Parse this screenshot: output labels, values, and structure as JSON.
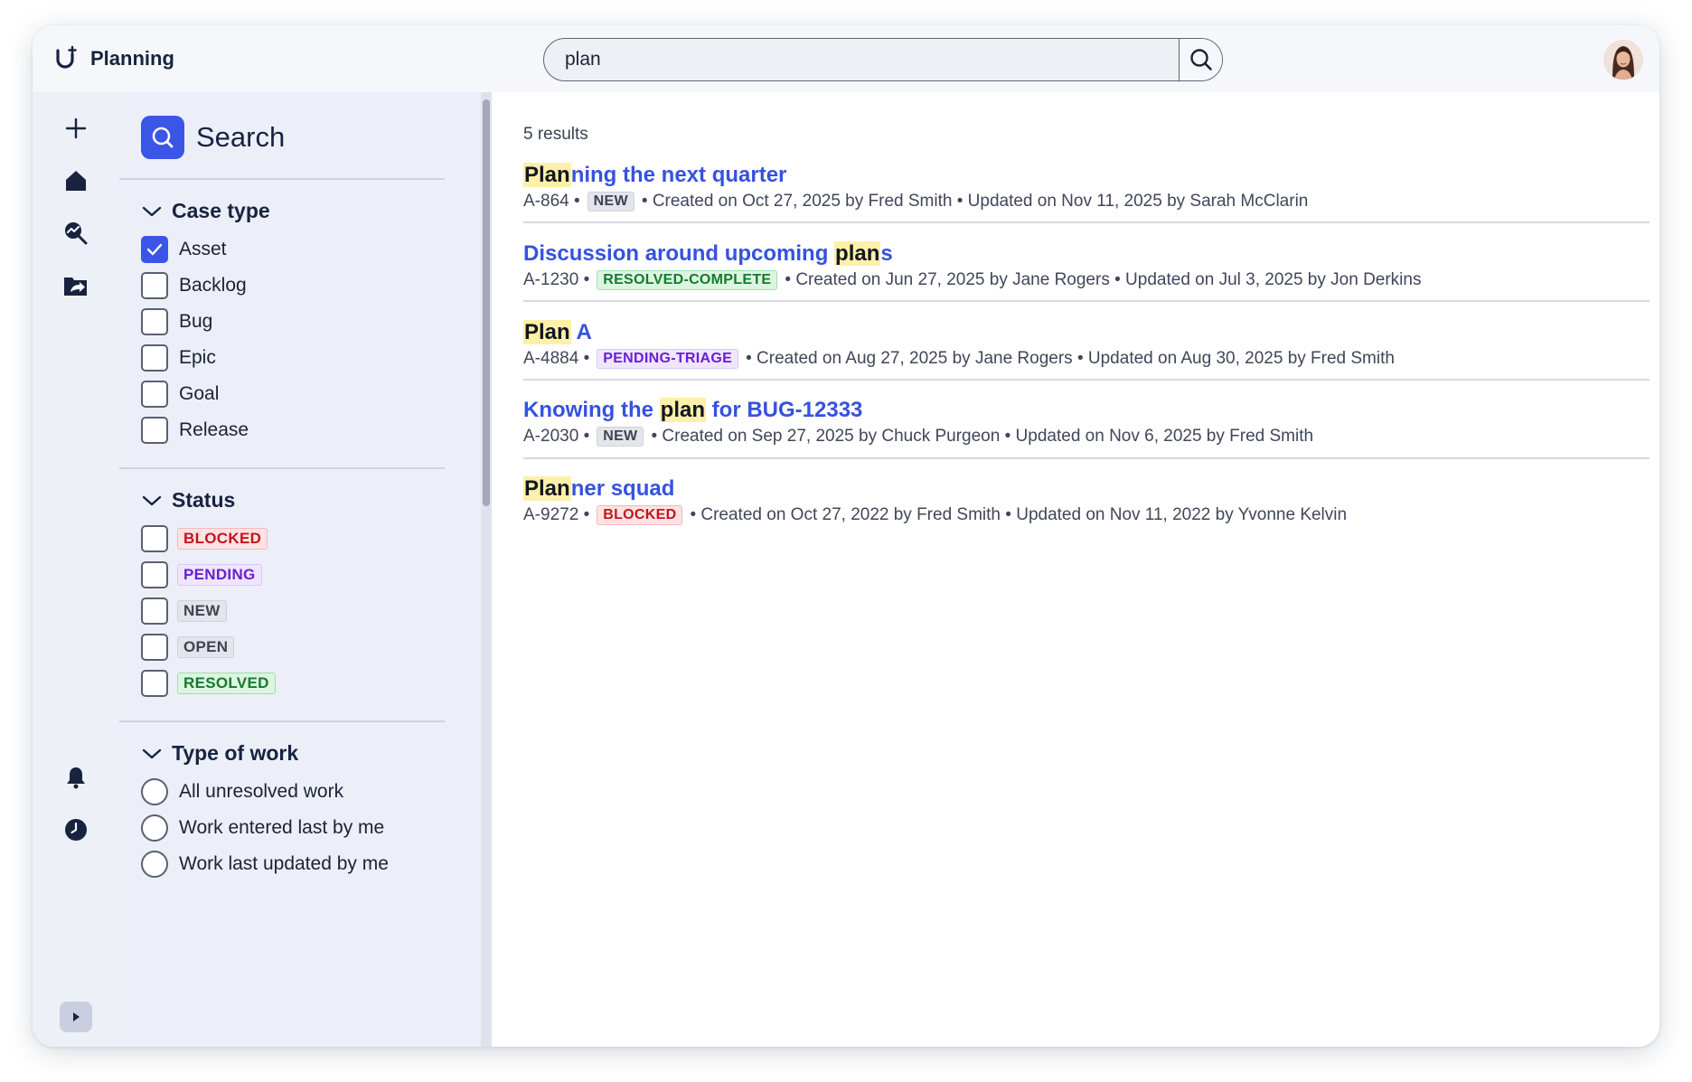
{
  "app": {
    "title": "Planning"
  },
  "search": {
    "query": "plan"
  },
  "sidebar": {
    "heading": "Search",
    "sections": {
      "case_type": {
        "label": "Case type",
        "options": [
          {
            "label": "Asset",
            "checked": true
          },
          {
            "label": "Backlog",
            "checked": false
          },
          {
            "label": "Bug",
            "checked": false
          },
          {
            "label": "Epic",
            "checked": false
          },
          {
            "label": "Goal",
            "checked": false
          },
          {
            "label": "Release",
            "checked": false
          }
        ]
      },
      "status": {
        "label": "Status",
        "options": [
          {
            "label": "BLOCKED"
          },
          {
            "label": "PENDING"
          },
          {
            "label": "NEW"
          },
          {
            "label": "OPEN"
          },
          {
            "label": "RESOLVED"
          }
        ]
      },
      "type_of_work": {
        "label": "Type of work",
        "options": [
          {
            "label": "All unresolved work"
          },
          {
            "label": "Work entered last by me"
          },
          {
            "label": "Work last updated by me"
          }
        ]
      }
    }
  },
  "results": {
    "count_label": "5 results",
    "items": [
      {
        "title_pre": "",
        "title_hl": "Plan",
        "title_post": "ning the next quarter",
        "id": "A-864",
        "status": "NEW",
        "created": "Created on Oct 27, 2025 by Fred Smith",
        "updated": "Updated on Nov 11, 2025 by Sarah McClarin"
      },
      {
        "title_pre": "Discussion around upcoming ",
        "title_hl": "plan",
        "title_post": "s",
        "id": "A-1230",
        "status": "RESOLVED-COMPLETE",
        "created": "Created on Jun 27, 2025 by Jane Rogers",
        "updated": "Updated on Jul 3, 2025 by Jon Derkins"
      },
      {
        "title_pre": "",
        "title_hl": "Plan",
        "title_post": " A",
        "id": "A-4884",
        "status": "PENDING-TRIAGE",
        "created": "Created on Aug 27, 2025 by Jane Rogers",
        "updated": "Updated on Aug 30, 2025 by Fred Smith"
      },
      {
        "title_pre": "Knowing the ",
        "title_hl": "plan",
        "title_post": " for BUG-12333",
        "id": "A-2030",
        "status": "NEW",
        "created": "Created on Sep 27, 2025 by Chuck Purgeon",
        "updated": "Updated on Nov 6, 2025 by Fred Smith"
      },
      {
        "title_pre": "",
        "title_hl": "Plan",
        "title_post": "ner squad",
        "id": "A-9272",
        "status": "BLOCKED",
        "created": "Created on Oct 27, 2022 by Fred Smith",
        "updated": "Updated on Nov 11, 2022 by Yvonne Kelvin"
      }
    ],
    "separator": "•"
  },
  "colors": {
    "accent": "#3b55e6",
    "link": "#3552e0",
    "highlight": "#fdf0a8",
    "navy": "#17233f"
  },
  "icons": {
    "rail": [
      "plus-icon",
      "home-icon",
      "search-analytics-icon",
      "folder-share-icon",
      "bell-icon",
      "clock-icon",
      "expand-icon"
    ]
  }
}
